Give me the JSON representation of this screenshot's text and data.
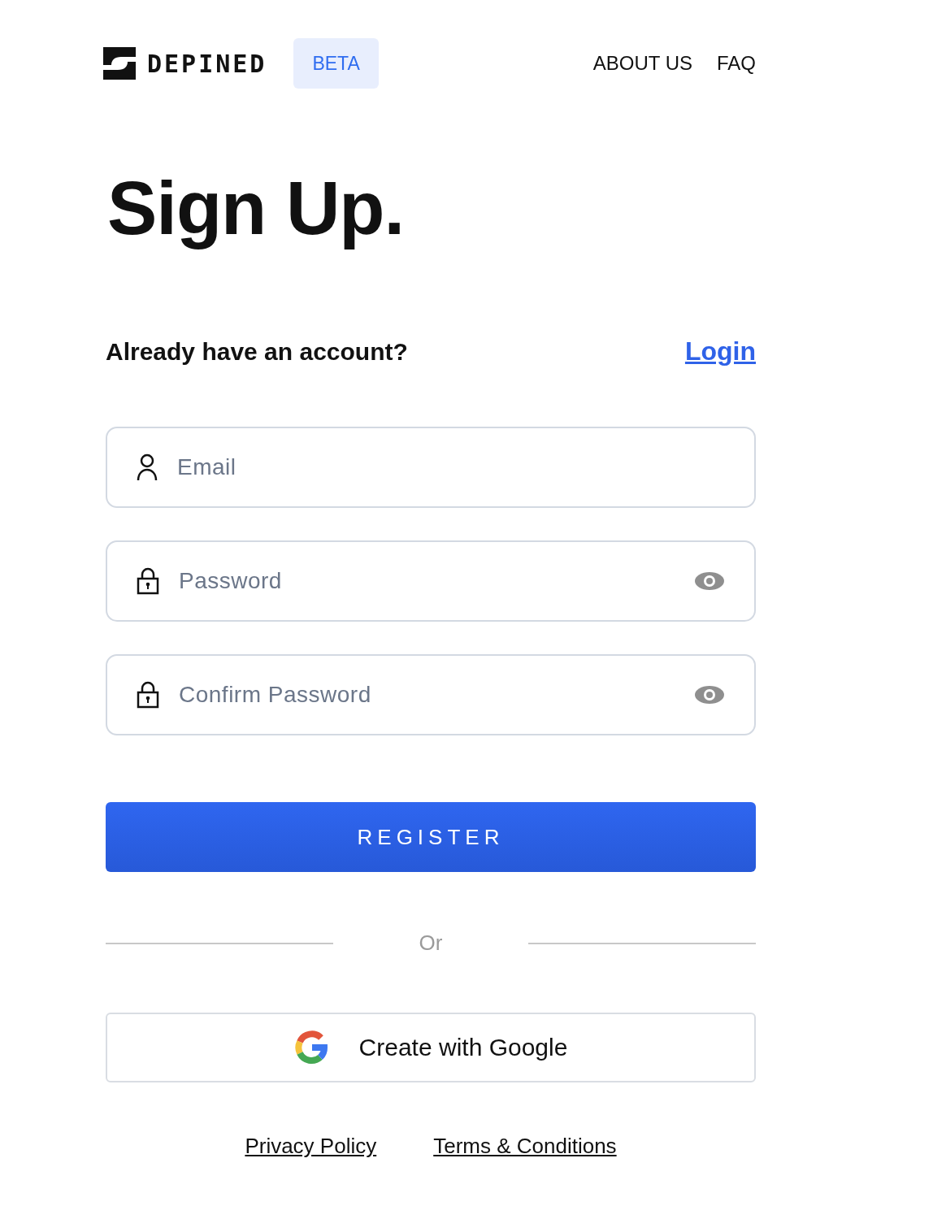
{
  "header": {
    "logo": "DEPINED",
    "badge": "BETA",
    "nav": [
      "ABOUT US",
      "FAQ"
    ]
  },
  "title": "Sign Up.",
  "account_prompt": {
    "text": "Already have an account?",
    "link": "Login"
  },
  "fields": [
    {
      "kind": "email",
      "placeholder": "Email"
    },
    {
      "kind": "password",
      "placeholder": "Password"
    },
    {
      "kind": "password",
      "placeholder": "Confirm Password"
    }
  ],
  "register_button": "REGISTER",
  "divider": "Or",
  "google_button": "Create with Google",
  "footer_links": [
    "Privacy Policy",
    "Terms & Conditions"
  ]
}
